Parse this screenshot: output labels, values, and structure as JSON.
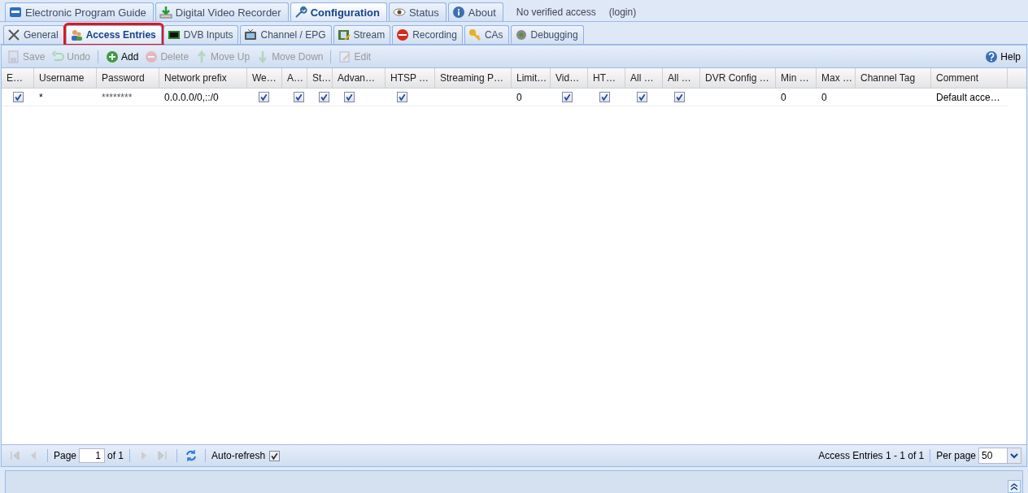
{
  "main_tabs": [
    {
      "label": "Electronic Program Guide",
      "selected": false
    },
    {
      "label": "Digital Video Recorder",
      "selected": false
    },
    {
      "label": "Configuration",
      "selected": true
    },
    {
      "label": "Status",
      "selected": false
    },
    {
      "label": "About",
      "selected": false
    }
  ],
  "access_status": "No verified access",
  "login_link": "(login)",
  "sub_tabs": [
    {
      "label": "General",
      "selected": false,
      "highlighted": false
    },
    {
      "label": "Access Entries",
      "selected": true,
      "highlighted": true
    },
    {
      "label": "DVB Inputs",
      "selected": false,
      "highlighted": false
    },
    {
      "label": "Channel / EPG",
      "selected": false,
      "highlighted": false
    },
    {
      "label": "Stream",
      "selected": false,
      "highlighted": false
    },
    {
      "label": "Recording",
      "selected": false,
      "highlighted": false
    },
    {
      "label": "CAs",
      "selected": false,
      "highlighted": false
    },
    {
      "label": "Debugging",
      "selected": false,
      "highlighted": false
    }
  ],
  "toolbar": [
    {
      "label": "Save",
      "disabled": true
    },
    {
      "label": "Undo",
      "disabled": true
    },
    {
      "label": "Add",
      "disabled": false
    },
    {
      "label": "Delete",
      "disabled": true
    },
    {
      "label": "Move Up",
      "disabled": true
    },
    {
      "label": "Move Down",
      "disabled": true
    },
    {
      "label": "Edit",
      "disabled": true
    }
  ],
  "help": "Help",
  "table": {
    "columns": [
      "E…",
      "Username",
      "Password",
      "Network prefix",
      "We…",
      "A…",
      "St…",
      "Advan…",
      "HTSP …",
      "Streaming P…",
      "Limit…",
      "Vid…",
      "HT…",
      "All …",
      "All …",
      "DVR Config …",
      "Min …",
      "Max …",
      "Channel Tag",
      "Comment"
    ],
    "rows": [
      [
        {
          "kind": "check",
          "checked": true
        },
        {
          "kind": "text",
          "text": "*"
        },
        {
          "kind": "masked",
          "text": "********"
        },
        {
          "kind": "text",
          "text": "0.0.0.0/0,::/0"
        },
        {
          "kind": "check",
          "checked": true
        },
        {
          "kind": "check",
          "checked": true
        },
        {
          "kind": "check",
          "checked": true
        },
        {
          "kind": "check",
          "checked": true
        },
        {
          "kind": "check",
          "checked": true
        },
        {
          "kind": "blank"
        },
        {
          "kind": "text",
          "text": "0"
        },
        {
          "kind": "check",
          "checked": true
        },
        {
          "kind": "check",
          "checked": true
        },
        {
          "kind": "check",
          "checked": true
        },
        {
          "kind": "check",
          "checked": true
        },
        {
          "kind": "blank"
        },
        {
          "kind": "text",
          "text": "0"
        },
        {
          "kind": "text",
          "text": "0"
        },
        {
          "kind": "blank"
        },
        {
          "kind": "text",
          "text": "Default acce…"
        }
      ]
    ]
  },
  "pager": {
    "page_label": "Page",
    "page": "1",
    "of": "of 1",
    "auto_refresh_label": "Auto-refresh",
    "auto_refresh": true,
    "summary": "Access Entries 1 - 1 of 1",
    "per_page_label": "Per page",
    "per_page": "50"
  }
}
